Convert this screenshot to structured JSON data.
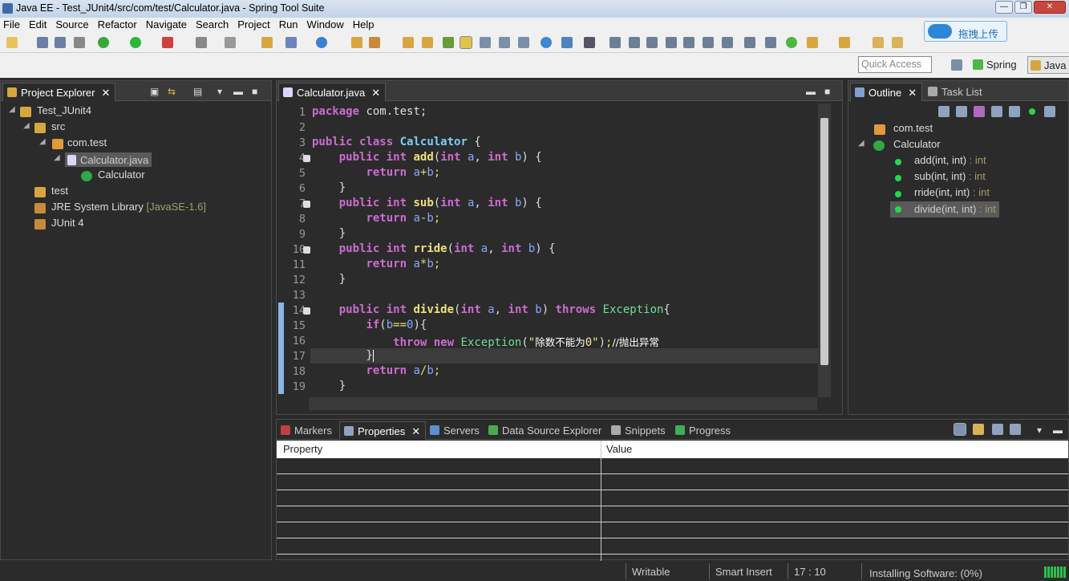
{
  "window": {
    "title": "Java EE - Test_JUnit4/src/com/test/Calculator.java - Spring Tool Suite"
  },
  "menu": [
    "File",
    "Edit",
    "Source",
    "Refactor",
    "Navigate",
    "Search",
    "Project",
    "Run",
    "Window",
    "Help"
  ],
  "quick_access": {
    "placeholder": "Quick Access"
  },
  "perspectives": {
    "spring": "Spring",
    "java": "Java"
  },
  "cloud_button": {
    "label": "拖拽上传"
  },
  "project_explorer": {
    "tab_label": "Project Explorer",
    "items": [
      {
        "label": "Test_JUnit4"
      },
      {
        "label": "src"
      },
      {
        "label": "com.test"
      },
      {
        "label": "Calculator.java"
      },
      {
        "label": "Calculator"
      },
      {
        "label": "test"
      },
      {
        "label": "JRE System Library",
        "suffix": "[JavaSE-1.6]"
      },
      {
        "label": "JUnit 4"
      }
    ]
  },
  "editor": {
    "tab_label": "Calculator.java",
    "lines": [
      "1",
      "2",
      "3",
      "4",
      "5",
      "6",
      "7",
      "8",
      "9",
      "10",
      "11",
      "12",
      "13",
      "14",
      "15",
      "16",
      "17",
      "18",
      "19"
    ]
  },
  "outline": {
    "tab_label": "Outline",
    "task_tab_label": "Task List",
    "package": "com.test",
    "class": "Calculator",
    "methods": [
      {
        "name": "add(int, int)",
        "ret": " : int"
      },
      {
        "name": "sub(int, int)",
        "ret": " : int"
      },
      {
        "name": "rride(int, int)",
        "ret": " : int"
      },
      {
        "name": "divide(int, int)",
        "ret": " : int"
      }
    ]
  },
  "bottom_tabs": {
    "markers": "Markers",
    "properties": "Properties",
    "servers": "Servers",
    "data_source": "Data Source Explorer",
    "snippets": "Snippets",
    "progress": "Progress"
  },
  "properties_table": {
    "col_property": "Property",
    "col_value": "Value"
  },
  "status": {
    "writable": "Writable",
    "insert_mode": "Smart Insert",
    "position": "17 : 10",
    "installing": "Installing Software: (0%)"
  }
}
